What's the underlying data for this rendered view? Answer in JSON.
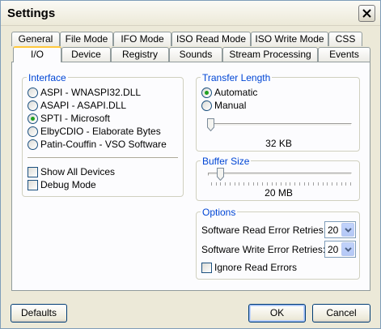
{
  "window": {
    "title": "Settings"
  },
  "tabs_row1": [
    "General",
    "File Mode",
    "IFO Mode",
    "ISO Read Mode",
    "ISO Write Mode",
    "CSS"
  ],
  "tabs_row2": [
    "I/O",
    "Device",
    "Registry",
    "Sounds",
    "Stream Processing",
    "Events"
  ],
  "active_tab": "I/O",
  "interface": {
    "label": "Interface",
    "options": [
      "ASPI - WNASPI32.DLL",
      "ASAPI - ASAPI.DLL",
      "SPTI - Microsoft",
      "ElbyCDIO - Elaborate Bytes",
      "Patin-Couffin - VSO Software"
    ],
    "selected": "SPTI - Microsoft",
    "checkboxes": [
      "Show All Devices",
      "Debug Mode"
    ]
  },
  "transfer_length": {
    "label": "Transfer Length",
    "options": [
      "Automatic",
      "Manual"
    ],
    "selected": "Automatic",
    "slider_value": "32 KB",
    "slider_position": 0.0
  },
  "buffer_size": {
    "label": "Buffer Size",
    "slider_value": "20 MB",
    "slider_position": 0.07
  },
  "options": {
    "label": "Options",
    "read_retries_label": "Software Read Error Retries:",
    "read_retries_value": "20",
    "write_retries_label": "Software Write Error Retries:",
    "write_retries_value": "20",
    "ignore_label": "Ignore Read Errors"
  },
  "buttons": {
    "defaults": "Defaults",
    "ok": "OK",
    "cancel": "Cancel"
  },
  "colors": {
    "group_label": "#0046d5",
    "radio_selected": "#21a121",
    "active_tab_top": "#ffc83c"
  },
  "icons": {
    "close": "close-icon",
    "dropdown": "chevron-down-icon"
  }
}
